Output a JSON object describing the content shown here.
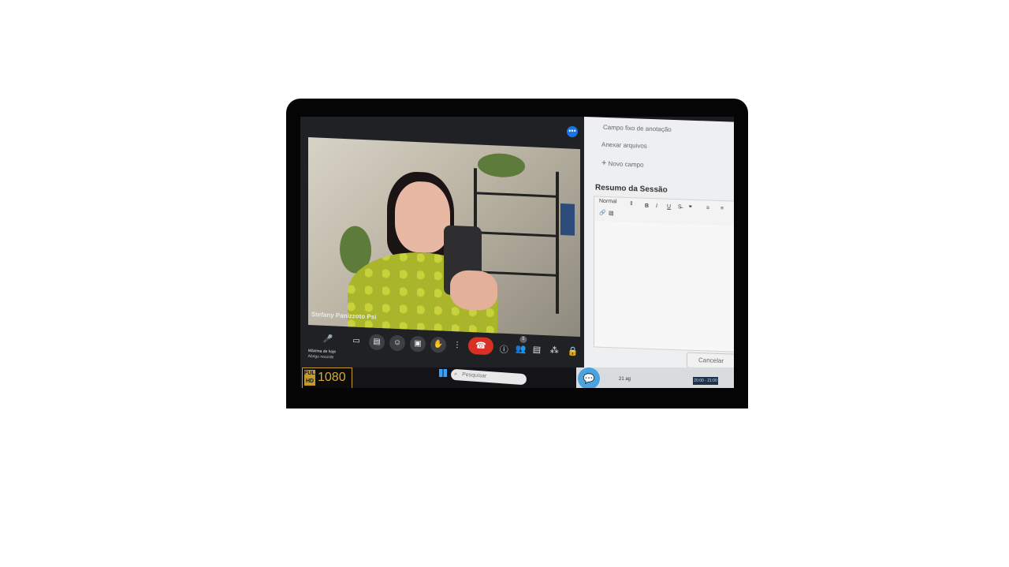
{
  "meet": {
    "participant_name": "Stefany Panizzoto Psi",
    "join_message_title": "Máxima de hoje",
    "join_message_sub": "Abrigo recorde",
    "participants_count": "1"
  },
  "taskbar": {
    "hd_label": "FULL HD",
    "resolution": "1080",
    "search_placeholder": "Pesquisar"
  },
  "form": {
    "fixed_field_label": "Campo fixo de anotação",
    "attach_label": "Anexar arquivos",
    "new_field_label": "Novo campo",
    "section_title": "Resumo da Sessão",
    "format_select": "Normal",
    "cancel_label": "Cancelar"
  },
  "bottom": {
    "date": "21 ag",
    "time": "20:00 - 21:00"
  }
}
